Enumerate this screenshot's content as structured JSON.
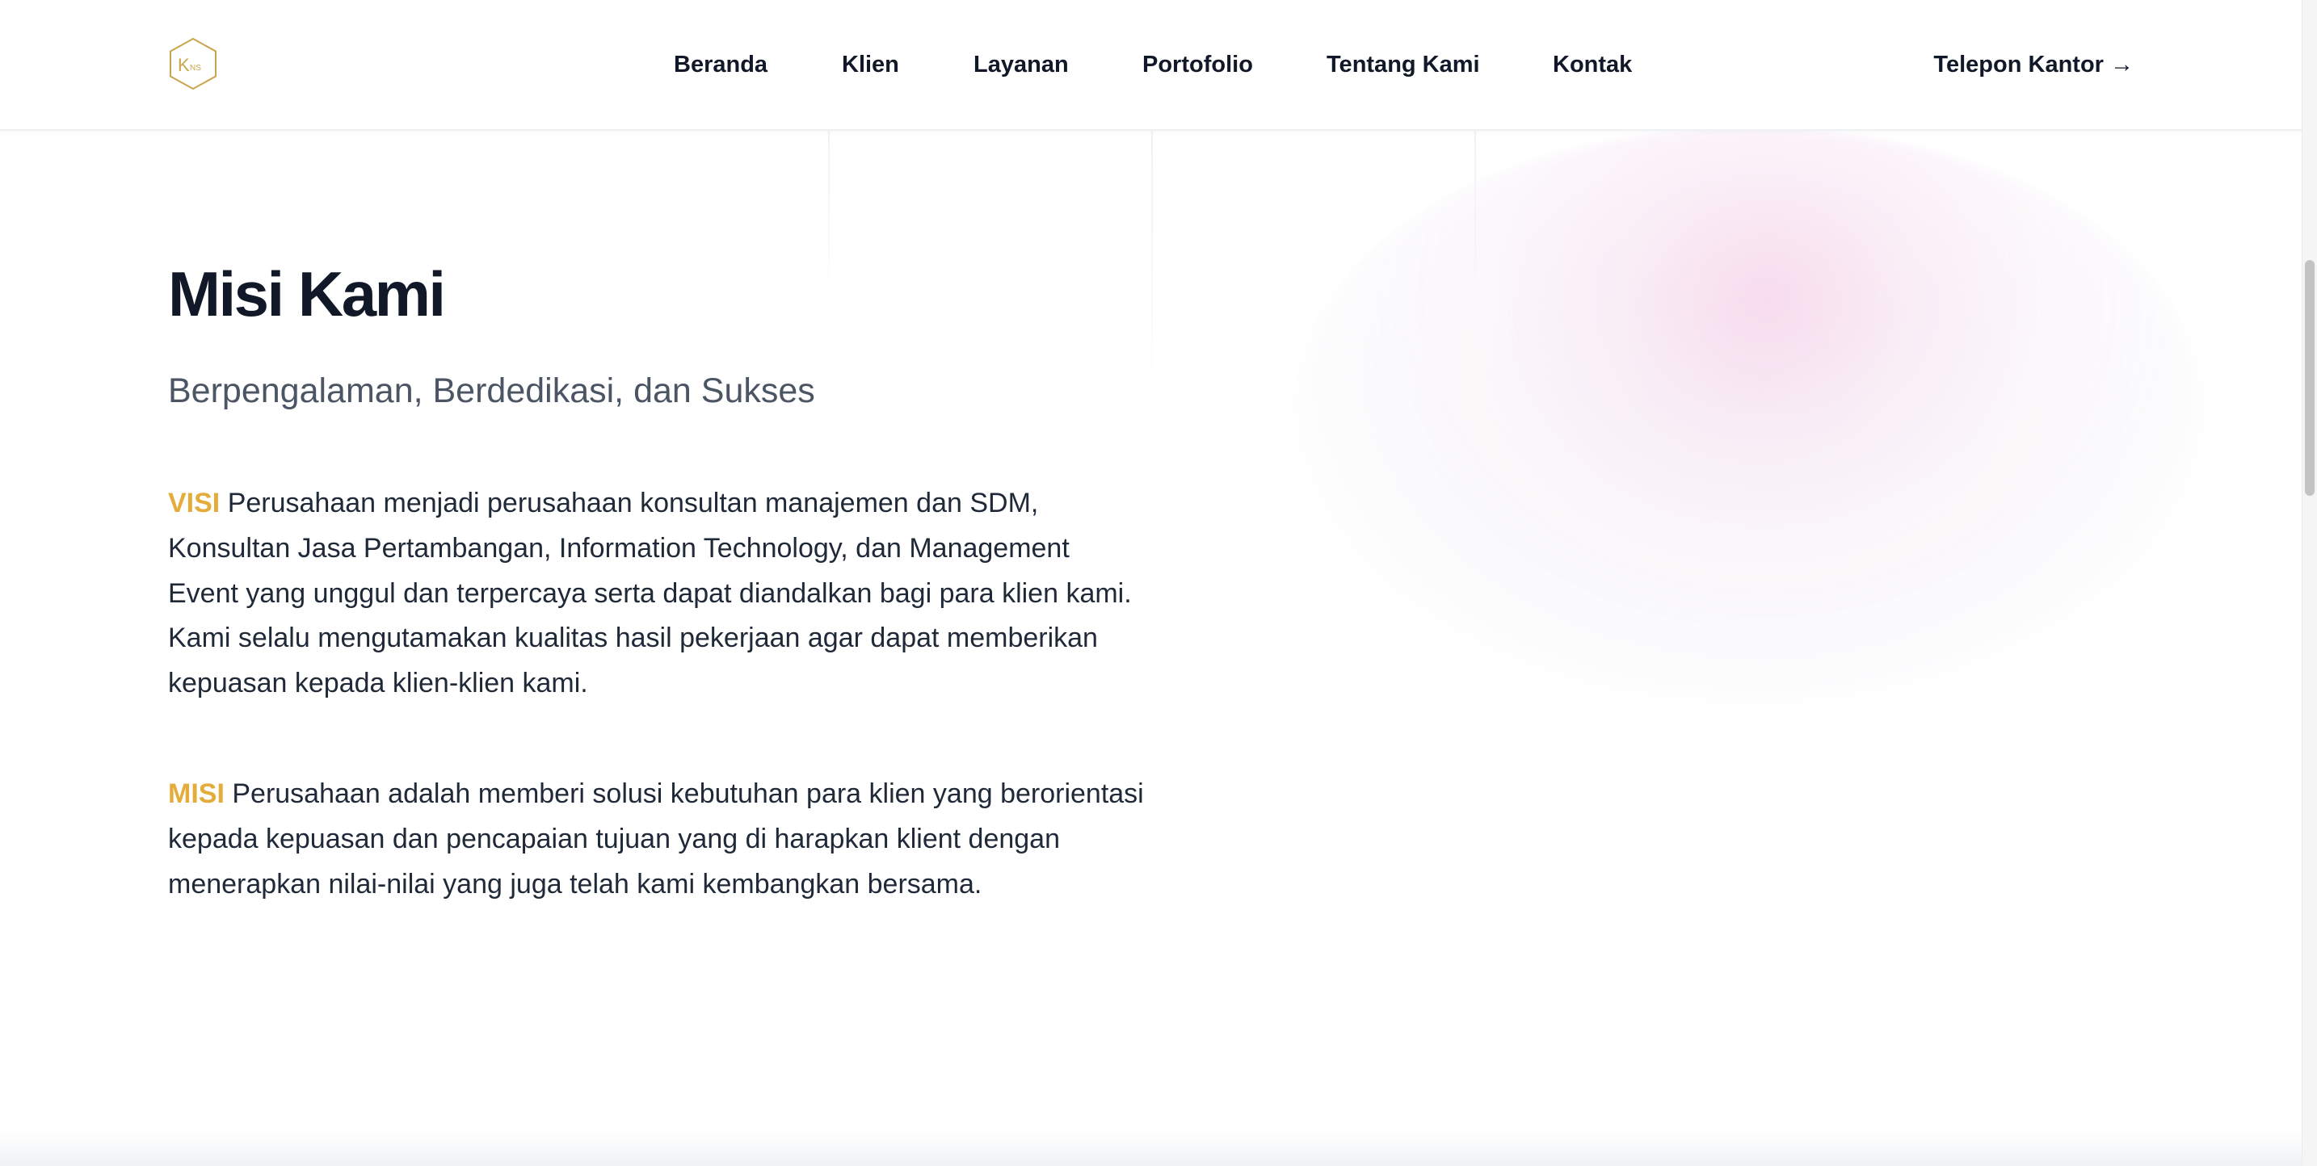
{
  "header": {
    "logo": {
      "letters": "KNS",
      "accent_color": "#C9A54B"
    },
    "nav": [
      {
        "label": "Beranda"
      },
      {
        "label": "Klien"
      },
      {
        "label": "Layanan"
      },
      {
        "label": "Portofolio"
      },
      {
        "label": "Tentang Kami"
      },
      {
        "label": "Kontak"
      }
    ],
    "cta_label": "Telepon Kantor →"
  },
  "main": {
    "title": "Misi Kami",
    "subtitle": "Berpengalaman, Berdedikasi, dan Sukses",
    "visi": {
      "tag": "VISI",
      "lines": [
        "Perusahaan menjadi perusahaan konsultan manajemen dan SDM,",
        "Konsultan Jasa Pertambangan, Information Technology, dan Management",
        "Event yang unggul dan terpercaya serta dapat diandalkan bagi para klien kami.",
        "Kami selalu mengutamakan kualitas hasil pekerjaan agar dapat memberikan",
        "kepuasan kepada klien-klien kami."
      ]
    },
    "misi": {
      "tag": "MISI",
      "lines": [
        "Perusahaan adalah memberi solusi kebutuhan para klien yang berorientasi",
        "kepada kepuasan dan pencapaian tujuan yang di harapkan klient dengan",
        "menerapkan nilai-nilai yang juga telah kami kembangkan bersama."
      ]
    }
  },
  "colors": {
    "accent": "#E3AC3B",
    "heading": "#111827",
    "body_text": "#1F2937",
    "subtitle": "#4B5563"
  }
}
